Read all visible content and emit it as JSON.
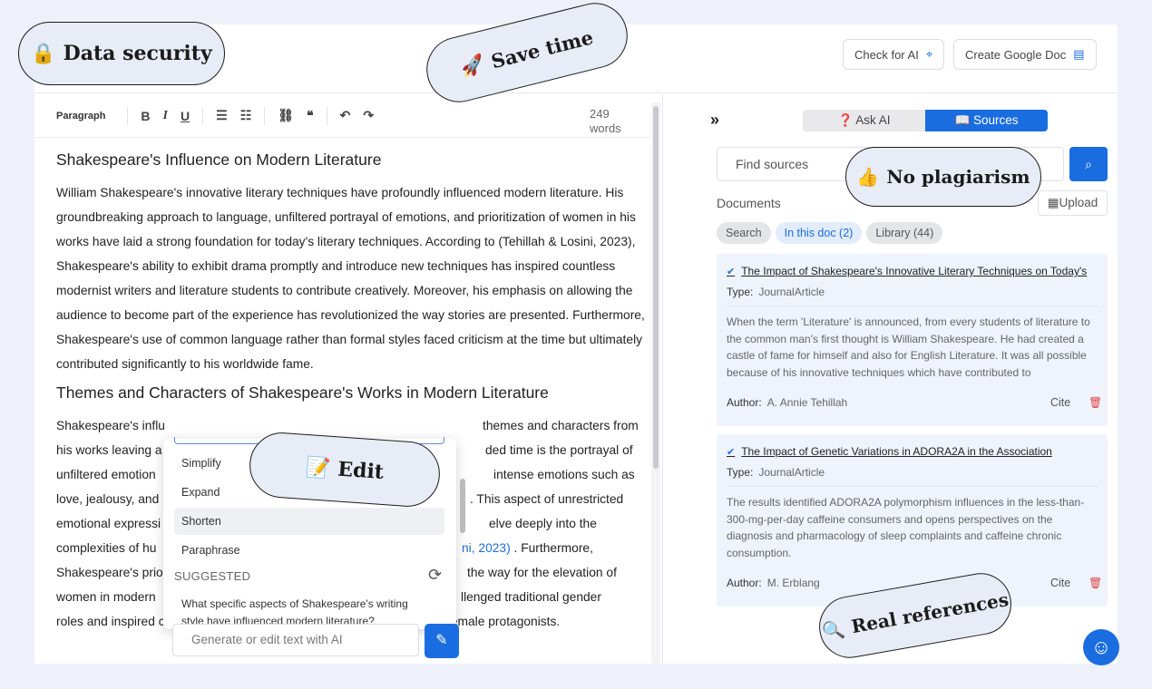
{
  "topbar": {
    "check_ai": "Check for AI",
    "google_doc": "Create Google Doc"
  },
  "toolbar": {
    "paragraph": "Paragraph",
    "bold": "B",
    "italic": "I",
    "underline": "U",
    "words_count": "249",
    "words_unit": "words"
  },
  "document": {
    "heading1": "Shakespeare's Influence on Modern Literature",
    "para1": "William Shakespeare's innovative literary techniques have profoundly influenced modern literature. His groundbreaking approach to language, unfiltered portrayal of emotions, and prioritization of women in his works have laid a strong foundation for today's literary techniques. According to (Tehillah & Losini, 2023), Shakespeare's ability to exhibit drama promptly and introduce new techniques has inspired countless modernist writers and literature students to contribute creatively. Moreover, his emphasis on allowing the audience to become part of the experience has revolutionized the way stories are presented. Furthermore, Shakespeare's use of common language rather than formal styles faced criticism at the time but ultimately contributed significantly to his worldwide fame.",
    "heading2": "Themes and Characters of Shakespeare's Works in Modern Literature",
    "para2_a": "Shakespeare's influ",
    "para2_b": "themes and characters from",
    "para2_c": "his works leaving a",
    "para2_d": "ded time is the portrayal of",
    "para2_e": "unfiltered emotion",
    "para2_f": "intense emotions such as",
    "para2_g": "love, jealousy, and",
    "para2_h": ". This aspect of unrestricted",
    "para2_i": "emotional expressi",
    "para2_j": "elve deeply into the",
    "para2_k": "complexities of hu",
    "para2_l_cite": "ni, 2023)",
    "para2_l": " . Furthermore,",
    "para2_m": "Shakespeare's prio",
    "para2_n": "the way for the elevation of",
    "para2_o": "women in modern",
    "para2_p": "llenged traditional gender",
    "para2_q": "roles and inspired contemporary authors to depict strong and complex female protagonists."
  },
  "ai_menu": {
    "options": [
      "Simplify",
      "Expand",
      "Shorten",
      "Paraphrase"
    ],
    "suggested_label": "SUGGESTED",
    "suggestion": "What specific aspects of Shakespeare's writing style have influenced modern literature?"
  },
  "ai_input": {
    "placeholder": "Generate or edit text with AI"
  },
  "sidebar": {
    "tabs": [
      "Ask AI",
      "Sources"
    ],
    "find_placeholder": "Find sources",
    "documents_label": "Documents",
    "upload_label": "Upload",
    "chips": [
      "Search",
      "In this doc (2)",
      "Library (44)"
    ],
    "cards": [
      {
        "title": "The Impact of Shakespeare's Innovative Literary Techniques on Today's",
        "type_label": "Type:",
        "type": "JournalArticle",
        "abstract": "When the term 'Literature' is announced, from every students of literature to the common man's first thought is William Shakespeare. He had created a castle of fame for himself and also for English Literature. It was all possible because of his innovative techniques which have contributed to",
        "author_label": "Author:",
        "author": "A. Annie Tehillah",
        "cite": "Cite"
      },
      {
        "title": "The Impact of Genetic Variations in ADORA2A in the Association",
        "type_label": "Type:",
        "type": "JournalArticle",
        "abstract": "The results identified ADORA2A polymorphism influences in the less-than-300-mg-per-day caffeine consumers and opens perspectives on the diagnosis and pharmacology of sleep complaints and caffeine chronic consumption.",
        "author_label": "Author:",
        "author": "M. Erblang",
        "cite": "Cite"
      }
    ]
  },
  "bubbles": {
    "data_security": "Data security",
    "save_time": "Save time",
    "no_plagiarism": "No plagiarism",
    "edit": "Edit",
    "real_references": "Real references"
  },
  "colors": {
    "accent": "#1a6de0",
    "bubble_bg": "#e7ecf7",
    "page_bg": "#eef1f9",
    "card_bg": "#eef3fc"
  },
  "icons": [
    "lock-icon",
    "rocket-icon",
    "thumbs-up-icon",
    "memo-icon",
    "magnifier-icon",
    "target-icon",
    "doc-icon",
    "chevrons-right-icon",
    "question-icon",
    "book-icon",
    "search-icon",
    "upload-icon",
    "check-badge-icon",
    "trash-icon",
    "refresh-icon",
    "magic-wand-icon",
    "smiley-icon"
  ]
}
